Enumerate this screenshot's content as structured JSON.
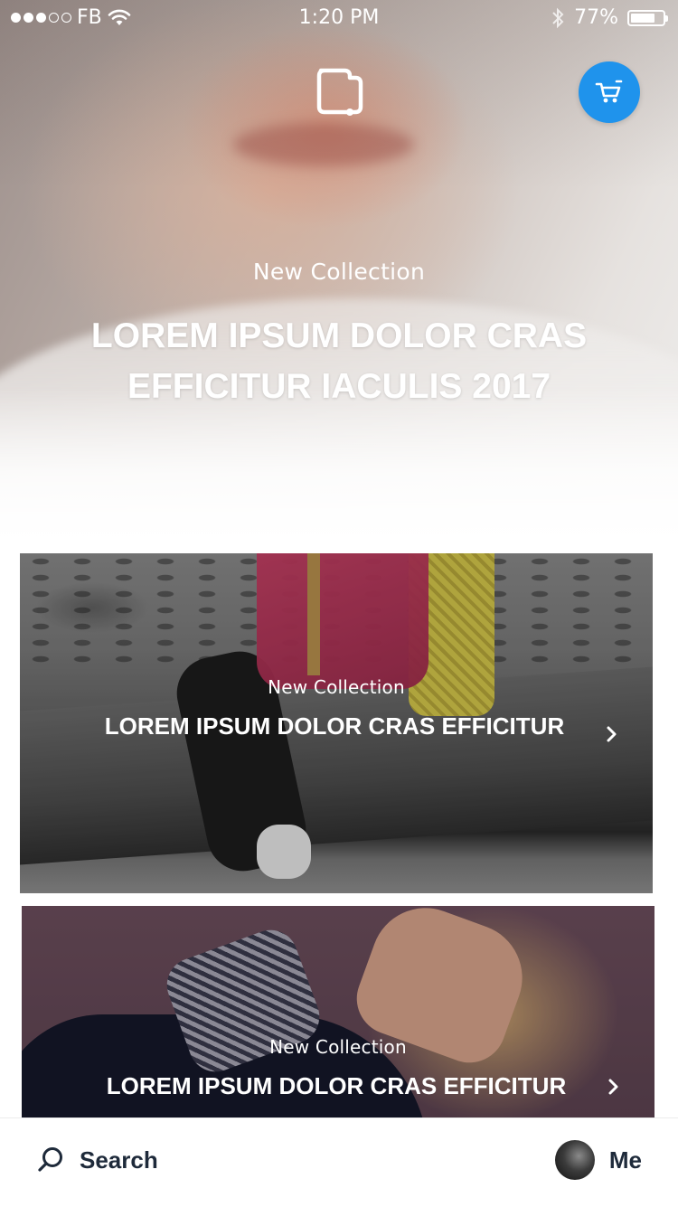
{
  "status_bar": {
    "carrier": "FB",
    "time": "1:20 PM",
    "battery": "77%",
    "battery_level": 0.77,
    "signal_dots": [
      true,
      true,
      true,
      false,
      false
    ]
  },
  "header": {
    "logo_icon": "shopping-bag-logo-icon",
    "cart_icon": "cart-icon",
    "accent_color": "#1f93ec"
  },
  "hero": {
    "subtitle": "New Collection",
    "title": "LOREM IPSUM DOLOR CRAS EFFICITUR IACULIS 2017"
  },
  "cards": [
    {
      "subtitle": "New Collection",
      "title": "LOREM IPSUM DOLOR CRAS EFFICITUR",
      "chevron_icon": "chevron-right-icon"
    },
    {
      "subtitle": "New Collection",
      "title": "LOREM IPSUM DOLOR CRAS EFFICITUR",
      "chevron_icon": "chevron-right-icon"
    }
  ],
  "tabbar": {
    "search_label": "Search",
    "me_label": "Me",
    "text_color": "#1e2a3a"
  }
}
